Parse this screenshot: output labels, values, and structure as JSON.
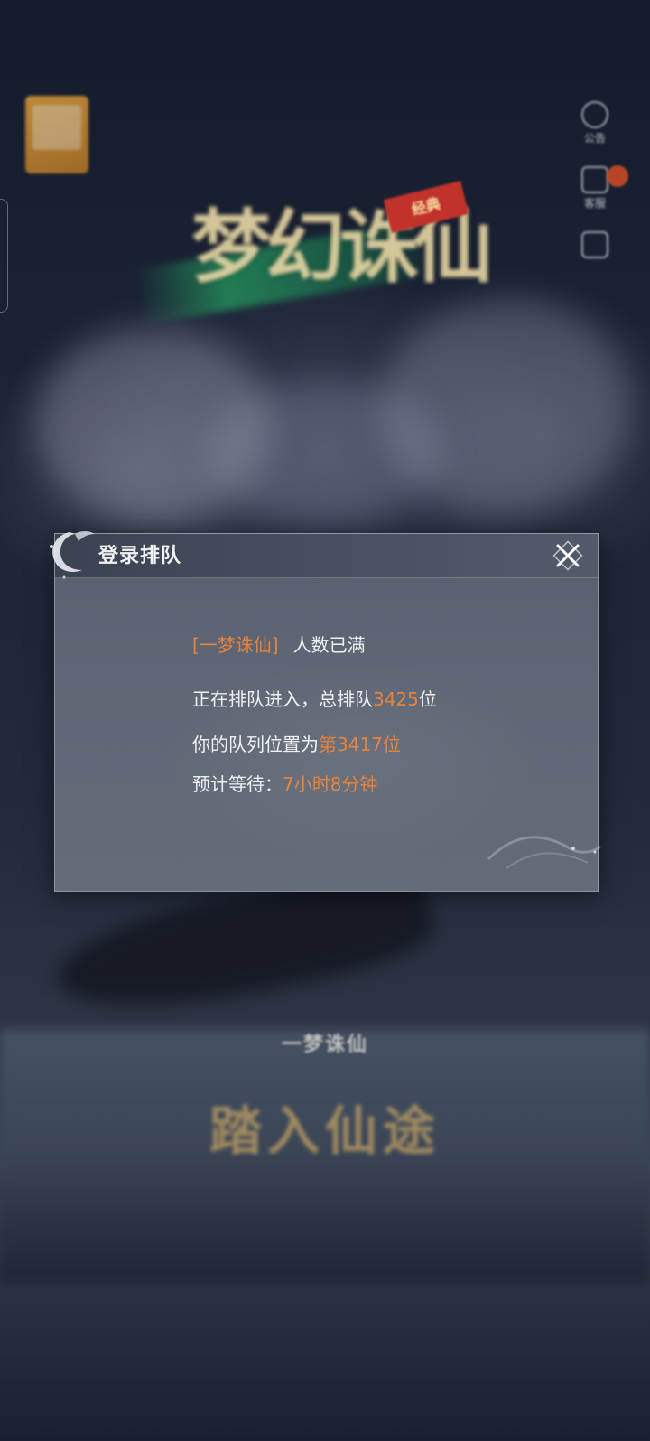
{
  "background": {
    "game_logo_badge": "",
    "title": {
      "calligraphy": "梦幻诛仙",
      "tag": "经典"
    },
    "side_menu": [
      {
        "icon": "announcement-icon",
        "label": "公告"
      },
      {
        "icon": "service-icon",
        "label": "客服"
      },
      {
        "icon": "more-icon",
        "label": ""
      }
    ],
    "tagline_small": "一梦诛仙",
    "tagline_large": "踏入仙途",
    "legal_text": ""
  },
  "dialog": {
    "title": "登录排队",
    "server_name": "[一梦诛仙]",
    "server_status": "人数已满",
    "queue_total_prefix": "正在排队进入，总排队",
    "queue_total": "3425",
    "queue_total_suffix": "位",
    "position_prefix": "你的队列位置为",
    "position_value": "第3417位",
    "wait_prefix": "预计等待：",
    "wait_value": "7小时8分钟"
  },
  "colors": {
    "accent": "#e8833a",
    "dialog_bg": "#5f6776",
    "text": "#f0f0f0"
  }
}
